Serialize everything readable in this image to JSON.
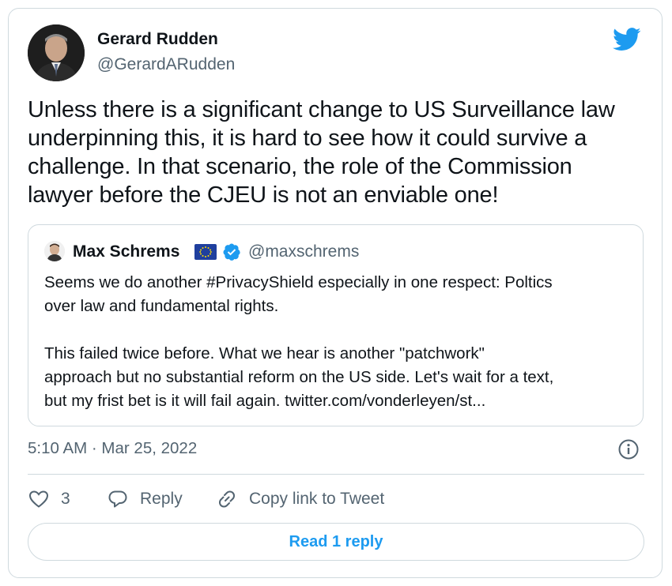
{
  "author": {
    "name": "Gerard Rudden",
    "handle": "@GerardARudden"
  },
  "tweet": {
    "text": "Unless there is a significant change to US Surveillance law\nunderpinning this, it is hard to see how it could survive a\nchallenge. In that scenario, the role of the Commission\nlawyer before the CJEU is not an enviable one!"
  },
  "quoted": {
    "name": "Max Schrems",
    "handle": "@maxschrems",
    "text": "Seems we do another #PrivacyShield especially in one respect: Poltics\nover law and fundamental rights.\n\nThis failed twice before. What we hear is another \"patchwork\"\napproach but no substantial reform on the US side. Let's wait for a text,\nbut my frist bet is it will fail again. twitter.com/vonderleyen/st..."
  },
  "timestamp": "5:10 AM · Mar 25, 2022",
  "actions": {
    "like_count": "3",
    "reply_label": "Reply",
    "copy_label": "Copy link to Tweet"
  },
  "read_reply_label": "Read 1 reply",
  "colors": {
    "accent": "#1d9bf0",
    "secondary_text": "#536471",
    "border": "#cfd9de"
  },
  "icons": [
    "twitter-bird-icon",
    "verified-badge-icon",
    "eu-flag-icon",
    "info-icon",
    "heart-icon",
    "reply-icon",
    "link-icon"
  ]
}
